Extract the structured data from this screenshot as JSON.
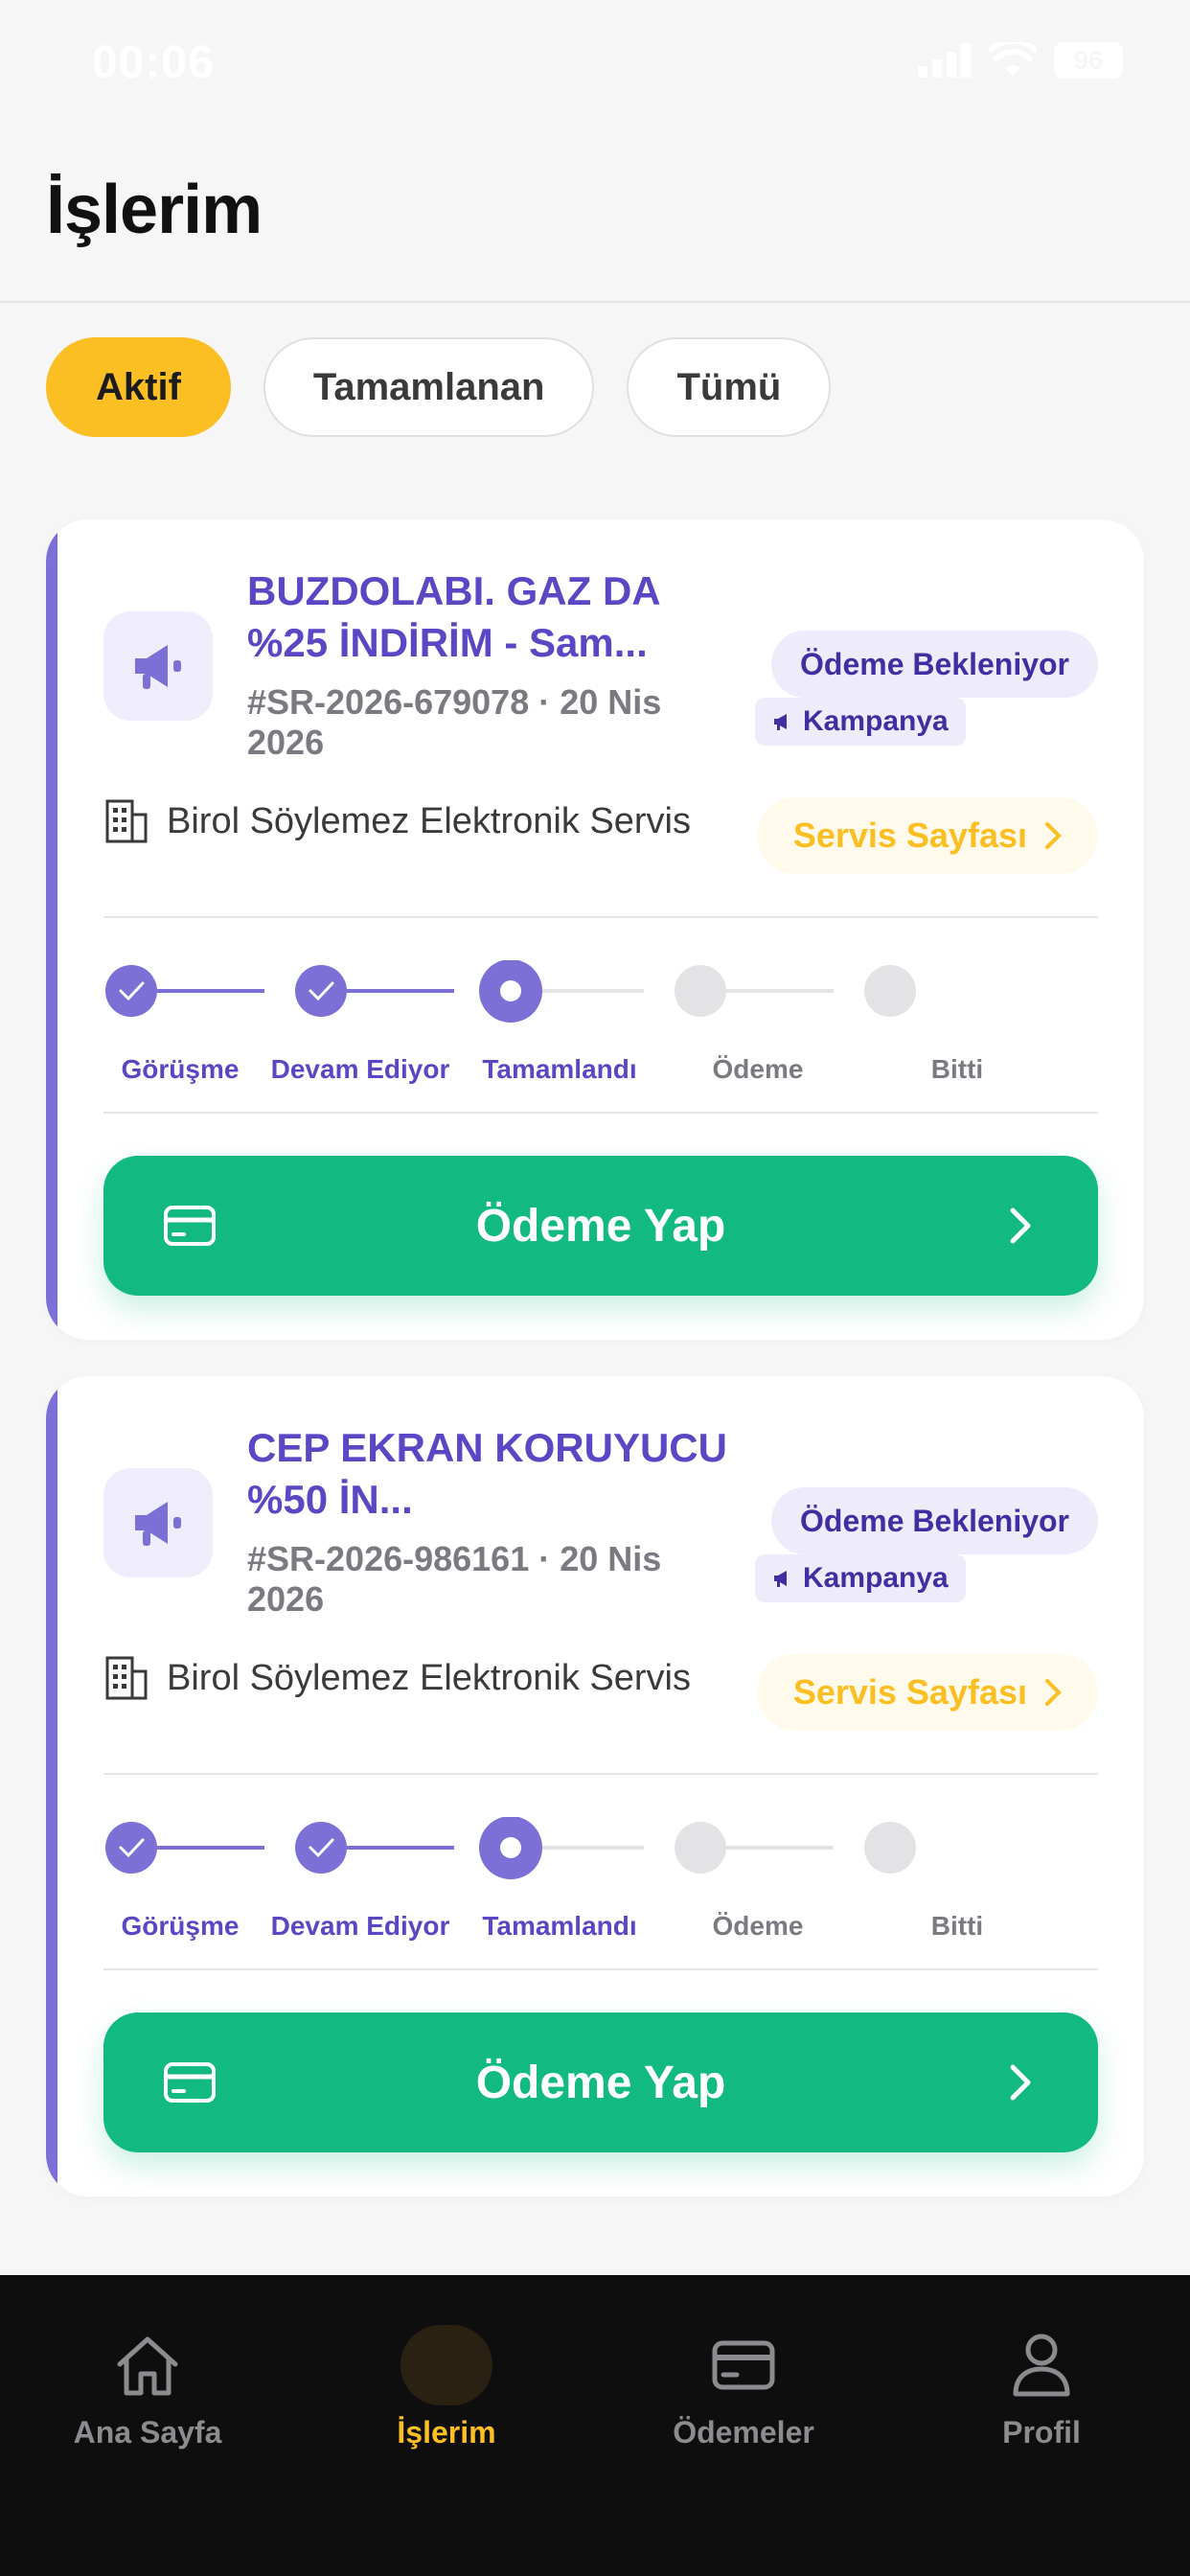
{
  "status_bar": {
    "time": "00:06",
    "battery": "96"
  },
  "header": {
    "title": "İşlerim"
  },
  "filters": [
    {
      "label": "Aktif",
      "active": true
    },
    {
      "label": "Tamamlanan",
      "active": false
    },
    {
      "label": "Tümü",
      "active": false
    }
  ],
  "cards": [
    {
      "title": "BUZDOLABI. GAZ DA %25 İNDİRİM - Sam...",
      "meta": "#SR-2026-679078 · 20 Nis 2026",
      "status_badge": "Ödeme Bekleniyor",
      "tag": "Kampanya",
      "service_name": "Birol Söylemez Elektronik Servis",
      "service_link": "Servis Sayfası",
      "steps": [
        "Görüşme",
        "Devam Ediyor",
        "Tamamlandı",
        "Ödeme",
        "Bitti"
      ],
      "current_step": 2,
      "pay_label": "Ödeme Yap"
    },
    {
      "title": "CEP EKRAN KORUYUCU %50 İN...",
      "meta": "#SR-2026-986161 · 20 Nis 2026",
      "status_badge": "Ödeme Bekleniyor",
      "tag": "Kampanya",
      "service_name": "Birol Söylemez Elektronik Servis",
      "service_link": "Servis Sayfası",
      "steps": [
        "Görüşme",
        "Devam Ediyor",
        "Tamamlandı",
        "Ödeme",
        "Bitti"
      ],
      "current_step": 2,
      "pay_label": "Ödeme Yap"
    }
  ],
  "bottom_nav": [
    {
      "label": "Ana Sayfa",
      "icon": "home-icon",
      "active": false
    },
    {
      "label": "İşlerim",
      "icon": "briefcase-icon",
      "active": true
    },
    {
      "label": "Ödemeler",
      "icon": "credit-card-icon",
      "active": false
    },
    {
      "label": "Profil",
      "icon": "user-icon",
      "active": false
    }
  ],
  "colors": {
    "accent_yellow": "#FBBF24",
    "accent_purple": "#7C6FD6",
    "pay_green": "#12B981",
    "nav_bg": "#0E0E0E"
  }
}
